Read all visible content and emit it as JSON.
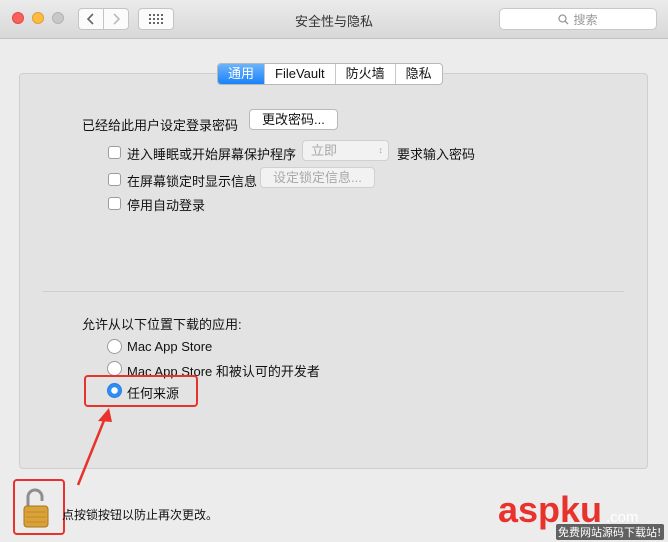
{
  "window": {
    "title": "安全性与隐私"
  },
  "search": {
    "placeholder": "搜索"
  },
  "tabs": [
    {
      "label": "通用",
      "active": true
    },
    {
      "label": "FileVault",
      "active": false
    },
    {
      "label": "防火墙",
      "active": false
    },
    {
      "label": "隐私",
      "active": false
    }
  ],
  "general": {
    "password_label": "已经给此用户设定登录密码",
    "change_password_button": "更改密码...",
    "require_password_label": "进入睡眠或开始屏幕保护程序",
    "require_password_select": "立即",
    "require_password_suffix": "要求输入密码",
    "show_message_label": "在屏幕锁定时显示信息",
    "set_lock_message_button": "设定锁定信息...",
    "disable_autologin_label": "停用自动登录"
  },
  "downloads": {
    "heading": "允许从以下位置下载的应用:",
    "options": [
      {
        "label": "Mac App Store",
        "selected": false
      },
      {
        "label": "Mac App Store 和被认可的开发者",
        "selected": false
      },
      {
        "label": "任何来源",
        "selected": true
      }
    ]
  },
  "footer": {
    "lock_text": "点按锁按钮以防止再次更改。"
  },
  "watermark": {
    "brand": "aspku",
    "suffix": ".com",
    "tagline": "免费网站源码下载站!"
  },
  "colors": {
    "accent": "#1a82fb",
    "annotation": "#e8322b",
    "watermark": "#e8322b"
  }
}
